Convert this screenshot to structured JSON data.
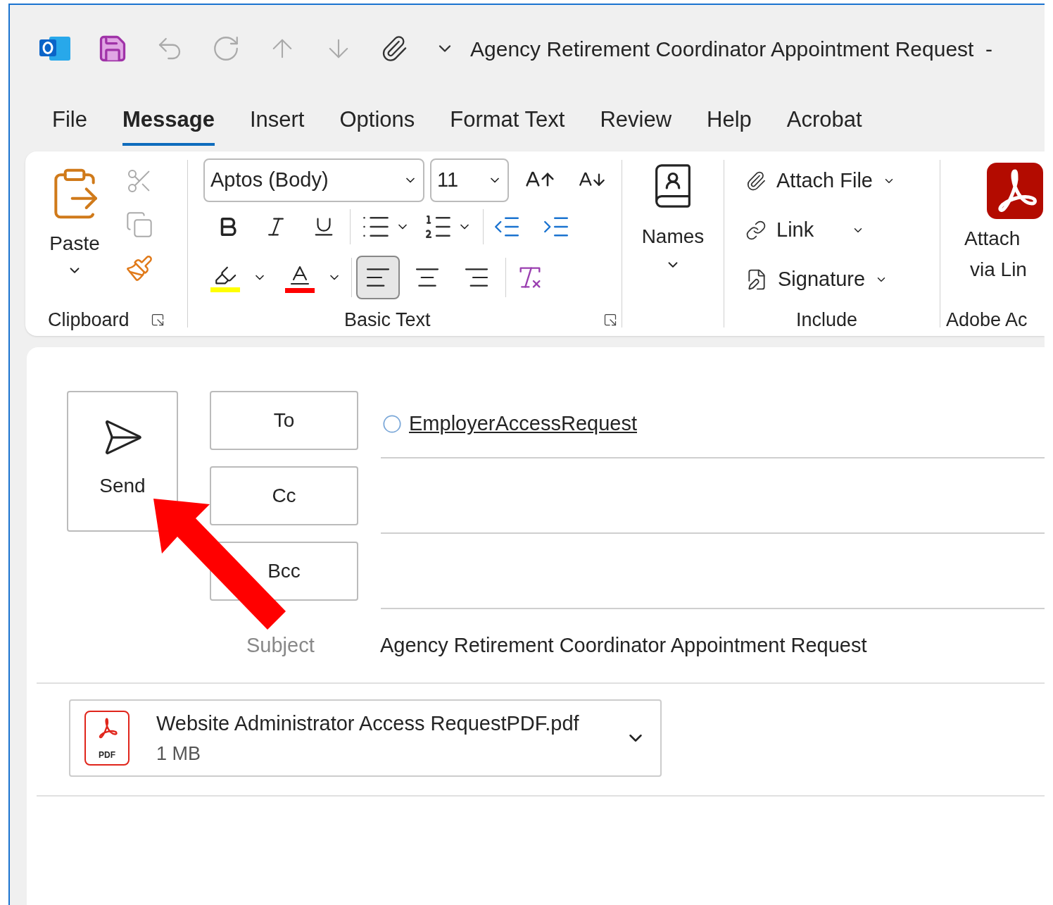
{
  "window": {
    "title": "Agency Retirement Coordinator Appointment Request  -"
  },
  "tabs": [
    {
      "label": "File",
      "selected": false
    },
    {
      "label": "Message",
      "selected": true
    },
    {
      "label": "Insert",
      "selected": false
    },
    {
      "label": "Options",
      "selected": false
    },
    {
      "label": "Format Text",
      "selected": false
    },
    {
      "label": "Review",
      "selected": false
    },
    {
      "label": "Help",
      "selected": false
    },
    {
      "label": "Acrobat",
      "selected": false
    }
  ],
  "ribbon": {
    "clipboard": {
      "paste": "Paste",
      "label": "Clipboard"
    },
    "basic_text": {
      "font": "Aptos (Body)",
      "size": "11",
      "label": "Basic Text",
      "alignment": [
        {
          "kind": "left",
          "selected": true
        },
        {
          "kind": "center",
          "selected": false
        },
        {
          "kind": "right",
          "selected": false
        }
      ]
    },
    "names": {
      "label": "Names"
    },
    "include": {
      "label": "Include",
      "items": [
        {
          "kind": "attach",
          "label": "Attach File"
        },
        {
          "kind": "link",
          "label": "Link"
        },
        {
          "kind": "signature",
          "label": "Signature"
        }
      ]
    },
    "adobe": {
      "lines": [
        "Attach",
        "via Lin"
      ],
      "label": "Adobe Ac"
    }
  },
  "compose": {
    "send": "Send",
    "fields": [
      {
        "button": "To",
        "value": "EmployerAccessRequest"
      },
      {
        "button": "Cc"
      },
      {
        "button": "Bcc"
      }
    ],
    "subject": {
      "label": "Subject",
      "value": "Agency Retirement Coordinator Appointment Request"
    },
    "attachment": {
      "name": "Website Administrator Access RequestPDF.pdf",
      "size": "1 MB",
      "badge": "PDF"
    }
  }
}
